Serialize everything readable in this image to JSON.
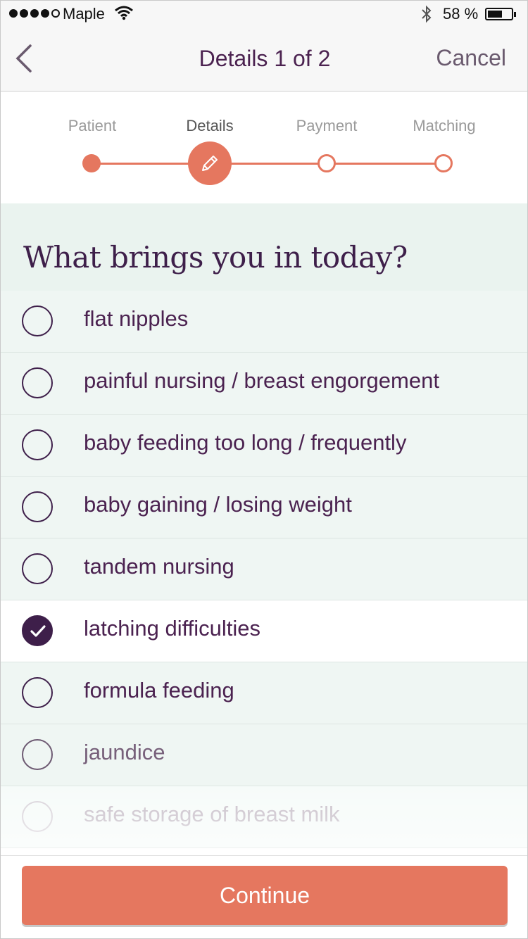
{
  "status_bar": {
    "carrier": "Maple",
    "battery_pct": "58 %",
    "battery_level": 0.58,
    "signal_bars_filled": 4,
    "signal_bars_total": 5
  },
  "nav": {
    "title": "Details 1 of 2",
    "cancel_label": "Cancel",
    "back_icon": "chevron-left-icon"
  },
  "stepper": {
    "steps": [
      {
        "label": "Patient",
        "state": "done"
      },
      {
        "label": "Details",
        "state": "current",
        "icon": "pencil-icon"
      },
      {
        "label": "Payment",
        "state": "todo"
      },
      {
        "label": "Matching",
        "state": "todo"
      }
    ],
    "accent_color": "#e5775f"
  },
  "question": {
    "title": "What brings you in today?"
  },
  "options": [
    {
      "label": "flat nipples",
      "checked": false
    },
    {
      "label": "painful nursing / breast engorgement",
      "checked": false
    },
    {
      "label": "baby feeding too long / frequently",
      "checked": false
    },
    {
      "label": "baby gaining / losing weight",
      "checked": false
    },
    {
      "label": "tandem nursing",
      "checked": false
    },
    {
      "label": "latching difficulties",
      "checked": true
    },
    {
      "label": "formula feeding",
      "checked": false
    },
    {
      "label": "jaundice",
      "checked": false
    },
    {
      "label": "safe storage of breast milk",
      "checked": false
    }
  ],
  "footer": {
    "continue_label": "Continue"
  },
  "colors": {
    "brand_purple": "#3e1f4a",
    "accent": "#e5775f",
    "list_bg": "#eff6f3"
  }
}
